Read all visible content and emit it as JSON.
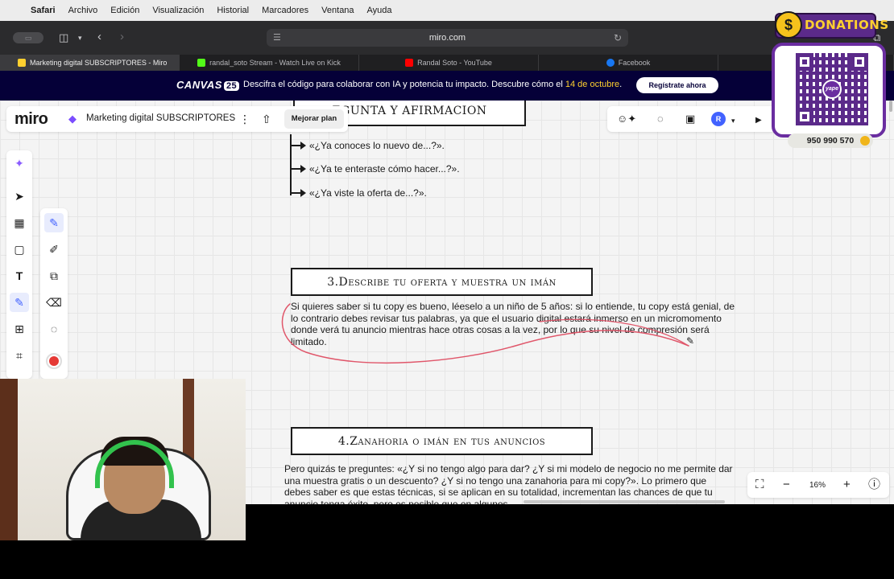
{
  "menubar": {
    "apple_glyph": "",
    "items": [
      "Safari",
      "Archivo",
      "Edición",
      "Visualización",
      "Historial",
      "Marcadores",
      "Ventana",
      "Ayuda"
    ]
  },
  "browser": {
    "url": "miro.com",
    "tabs": [
      {
        "title": "Marketing digital SUBSCRIPTORES - Miro",
        "favicon": "miro-icon",
        "color": "#ffd02f"
      },
      {
        "title": "randal_soto Stream - Watch Live on Kick",
        "favicon": "kick-icon",
        "color": "#53fc18"
      },
      {
        "title": "Randal Soto - YouTube",
        "favicon": "youtube-icon",
        "color": "#ff0000"
      },
      {
        "title": "Facebook",
        "favicon": "facebook-icon",
        "color": "#1877f2"
      }
    ]
  },
  "banner": {
    "logo": "CANVAS",
    "logo_number": "25",
    "text": "Descifra el código para colaborar con IA y potencia tu impacto. Descubre cómo el ",
    "date": "14 de octubre",
    "text_end": ".",
    "cta": "Regístrate ahora"
  },
  "miro": {
    "logo": "miro",
    "board_name": "Marketing digital SUBSCRIPTORES",
    "upgrade_label": "Mejorar plan",
    "avatar_initial": "R",
    "zoom": "16%"
  },
  "board": {
    "section2_title": "EGUNTA Y AFIRMACION",
    "bullets": [
      "«¿Ya conoces lo nuevo de...?».",
      "«¿Ya te enteraste cómo hacer...?».",
      "«¿Ya viste la oferta de...?»."
    ],
    "section3_title": "3.Describe tu oferta y muestra un imán",
    "section3_body": "Si quieres saber si tu copy es bueno, léeselo a un niño de 5 años: si lo entiende, tu copy está genial, de lo contrario debes revisar tus palabras, ya que el usuario digital estará inmerso en un micromomento donde verá tu anuncio mientras hace otras cosas a la vez, por lo que su nivel de compresión será limitado.",
    "section4_title": "4.Zanahoria o imán en tus anuncios",
    "section4_body": "Pero quizás te preguntes: «¿Y si no tengo algo para dar? ¿Y si mi modelo de negocio no me permite dar una muestra gratis o un descuento? ¿Y si no tengo una zanahoria para mi copy?». Lo primero que debes saber es que estas técnicas, si se aplican en su totalidad, incrementan las chances de que tu anuncio tenga éxito, pero es posible que en algunos"
  },
  "overlay": {
    "donations_label": "DONATIONS",
    "coin_symbol": "$",
    "qr_brand": "yape",
    "phone": "950 990 570"
  },
  "colors": {
    "miro_navy": "#050038",
    "miro_yellow": "#ffd02f",
    "miro_blue": "#4262ff",
    "annotation_red": "#e0566a",
    "donation_purple": "#5b2a8a"
  }
}
